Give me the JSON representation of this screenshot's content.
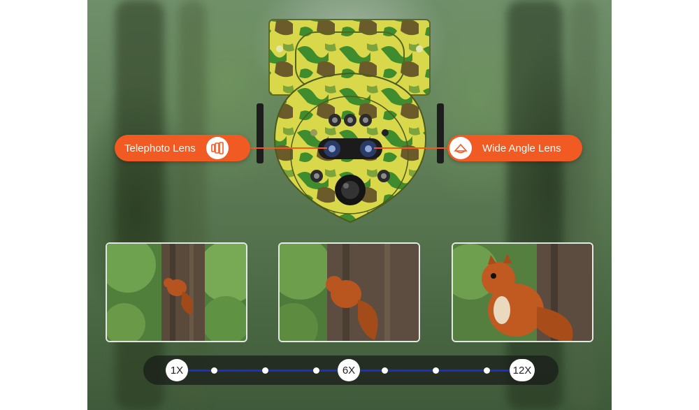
{
  "labels": {
    "telephoto": "Telephoto Lens",
    "wide": "Wide Angle Lens"
  },
  "zoom": {
    "marks": [
      "1X",
      "6X",
      "12X"
    ]
  },
  "photos": [
    {
      "name": "squirrel-photo-1x"
    },
    {
      "name": "squirrel-photo-6x"
    },
    {
      "name": "squirrel-photo-12x"
    }
  ],
  "icons": {
    "telephoto": "telephoto-lens-icon",
    "wide": "wide-angle-lens-icon"
  },
  "colors": {
    "accent": "#f15a22",
    "zoom_line": "#1531c9",
    "camo_light": "#d9d84a",
    "camo_green": "#3e8c2e",
    "camo_brown": "#6b5a2a"
  }
}
